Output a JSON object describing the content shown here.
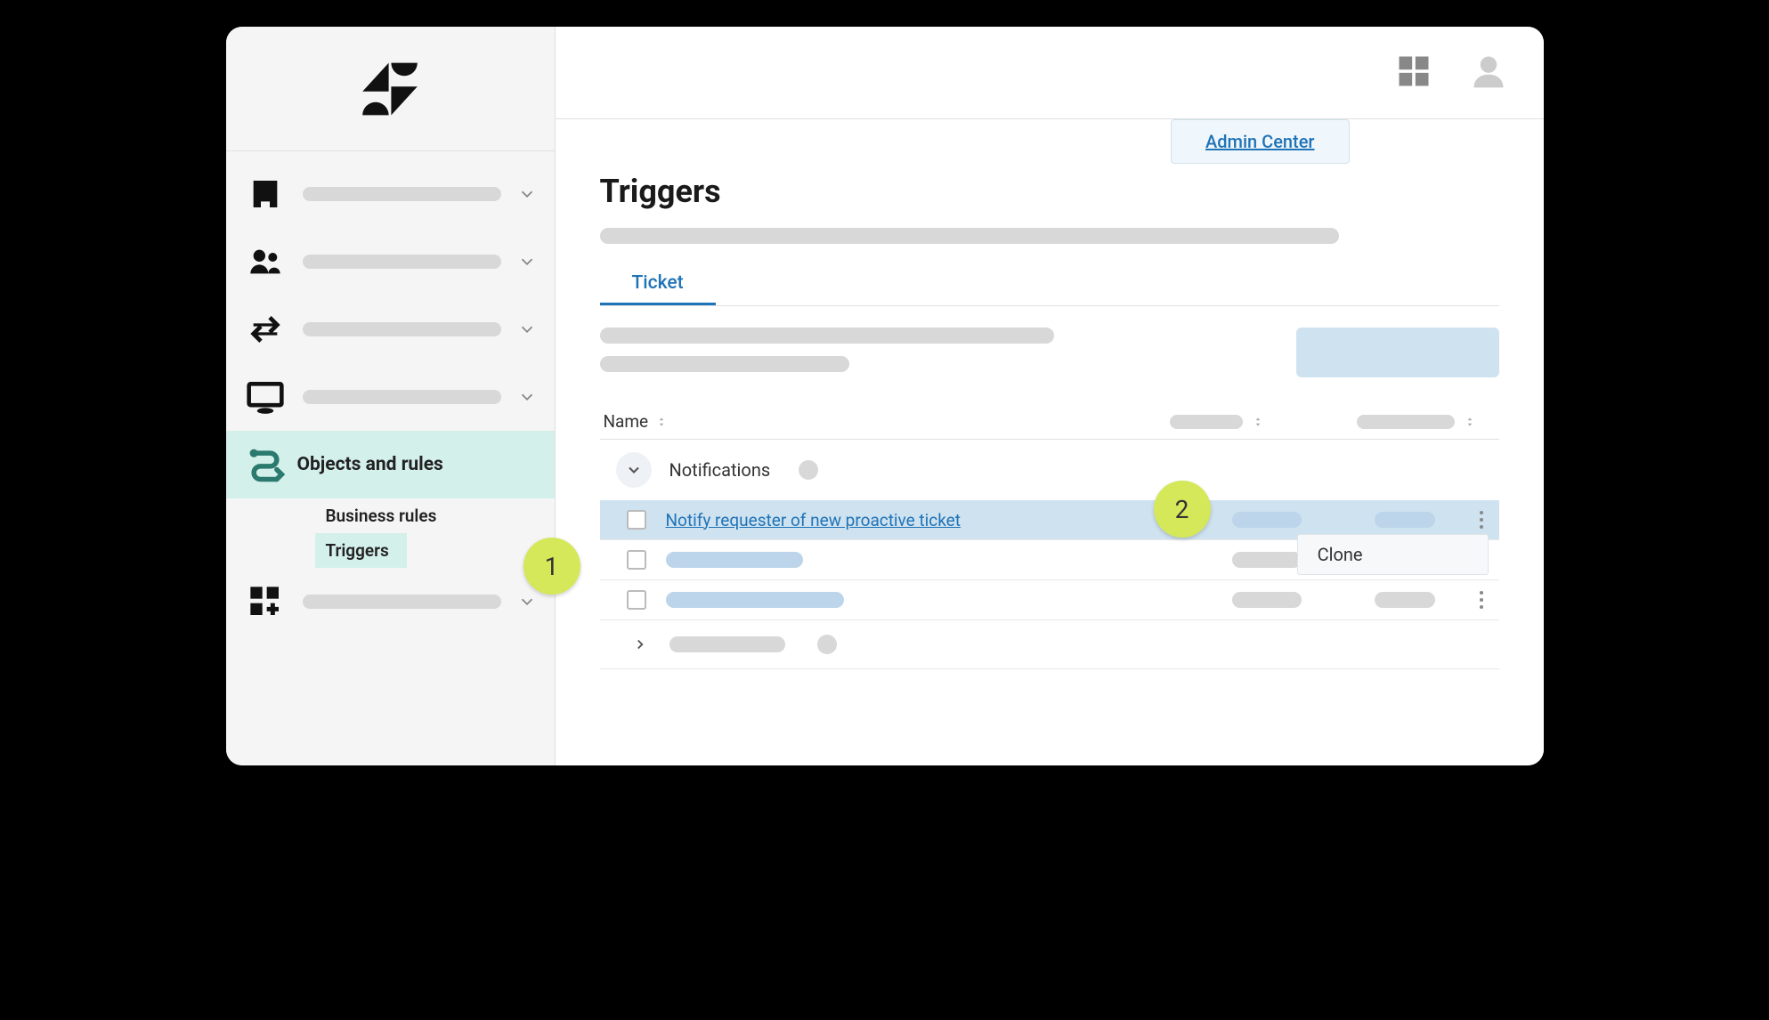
{
  "tooltip": {
    "text": "Admin Center"
  },
  "sidebar": {
    "active_label": "Objects and rules",
    "sub": {
      "business_rules": "Business rules",
      "triggers": "Triggers"
    }
  },
  "page": {
    "title": "Triggers",
    "tab": "Ticket"
  },
  "table": {
    "header_name": "Name",
    "group_label": "Notifications",
    "row1_link": "Notify requester of new proactive ticket",
    "menu_clone": "Clone"
  },
  "callouts": {
    "one": "1",
    "two": "2"
  }
}
